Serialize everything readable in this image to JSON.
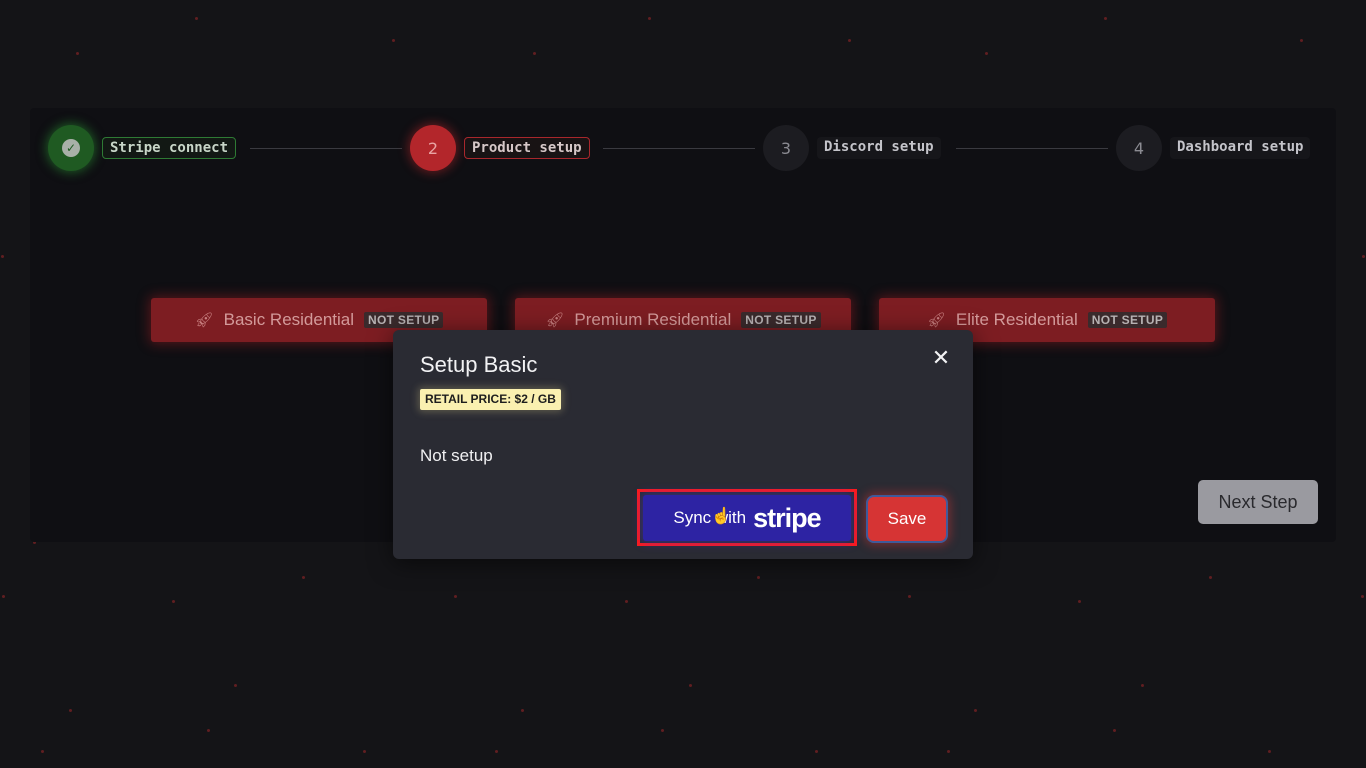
{
  "stepper": {
    "steps": [
      {
        "number": "",
        "label": "Stripe connect",
        "status": "completed"
      },
      {
        "number": "2",
        "label": "Product setup",
        "status": "active"
      },
      {
        "number": "3",
        "label": "Discord setup",
        "status": "pending"
      },
      {
        "number": "4",
        "label": "Dashboard setup",
        "status": "pending"
      }
    ]
  },
  "products": [
    {
      "name": "Basic Residential",
      "badge": "NOT SETUP",
      "icon": "rocket-icon"
    },
    {
      "name": "Premium Residential",
      "badge": "NOT SETUP",
      "icon": "rocket-icon"
    },
    {
      "name": "Elite Residential",
      "badge": "NOT SETUP",
      "icon": "rocket-icon"
    }
  ],
  "next_step_label": "Next Step",
  "modal": {
    "title": "Setup Basic",
    "price_tag": "RETAIL PRICE: $2 / GB",
    "status_text": "Not setup",
    "sync_button": {
      "prefix": "Sync with",
      "brand": "stripe"
    },
    "save_label": "Save",
    "close_icon": "close-icon"
  },
  "colors": {
    "background": "#141417",
    "accent_red": "#d63434",
    "stripe_purple": "#2d23a3",
    "success_green": "#1f5a22",
    "highlight": "#ff1a1a"
  }
}
